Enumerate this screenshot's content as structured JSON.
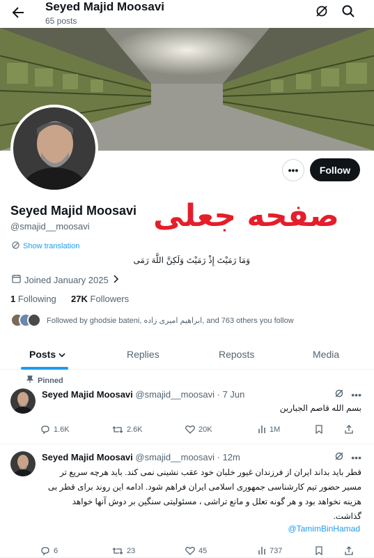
{
  "header": {
    "title": "Seyed Majid Moosavi",
    "subtitle": "65 posts"
  },
  "profile": {
    "display_name": "Seyed Majid Moosavi",
    "handle": "@smajid__moosavi",
    "stamp_text": "صفحه جعلی",
    "translate_label": "Show translation",
    "bio": "وَمَا رَمَيْتَ إِذْ رَمَيْتَ وَلَكِنَّ اللَّهَ رَمَى",
    "joined": "Joined January 2025",
    "following_count": "1",
    "following_label": "Following",
    "followers_count": "27K",
    "followers_label": "Followers",
    "followed_by": "Followed by ghodsie bateni, ابراهیم امیری زاده, and 763 others you follow",
    "more_label": "•••",
    "follow_label": "Follow"
  },
  "tabs": [
    {
      "label": "Posts"
    },
    {
      "label": "Replies"
    },
    {
      "label": "Reposts"
    },
    {
      "label": "Media"
    }
  ],
  "posts": [
    {
      "pinned_label": "Pinned",
      "name": "Seyed Majid Moosavi",
      "meta": "@smajid__moosavi · 7 Jun",
      "text": "بسم الله قاصم الجبارین",
      "replies": "1.6K",
      "reposts": "2.6K",
      "likes": "20K",
      "views": "1M"
    },
    {
      "name": "Seyed Majid Moosavi",
      "meta": "@smajid__moosavi · 12m",
      "lines": [
        "قطر باید بداند ایران از فرزندان غیور خلبان خود عقب نشینی نمی کند. باید هرچه سریع تر",
        "مسیر حضور تیم کارشناسی جمهوری اسلامی ایران فراهم شود. ادامه این روند برای قطر بی",
        "هزینه نخواهد بود و هر گونه تعلل و مانع تراشی ، مسئولیتی سنگین بر دوش آنها خواهد",
        "گذاشت."
      ],
      "mention": "@TamimBinHamad",
      "replies": "6",
      "reposts": "23",
      "likes": "45",
      "views": "737"
    }
  ],
  "icons": {
    "back": "arrow-left-icon",
    "grok": "grok-icon",
    "search": "search-icon",
    "globe": "globe-icon",
    "calendar": "calendar-icon",
    "reply": "reply-icon",
    "repost": "repost-icon",
    "like": "heart-icon",
    "views": "views-icon",
    "pin": "pin-icon",
    "share": "share-icon"
  },
  "colors": {
    "accent": "#1d9bf0",
    "stamp": "#e41e2a",
    "text": "#0f1419",
    "muted": "#536471"
  }
}
